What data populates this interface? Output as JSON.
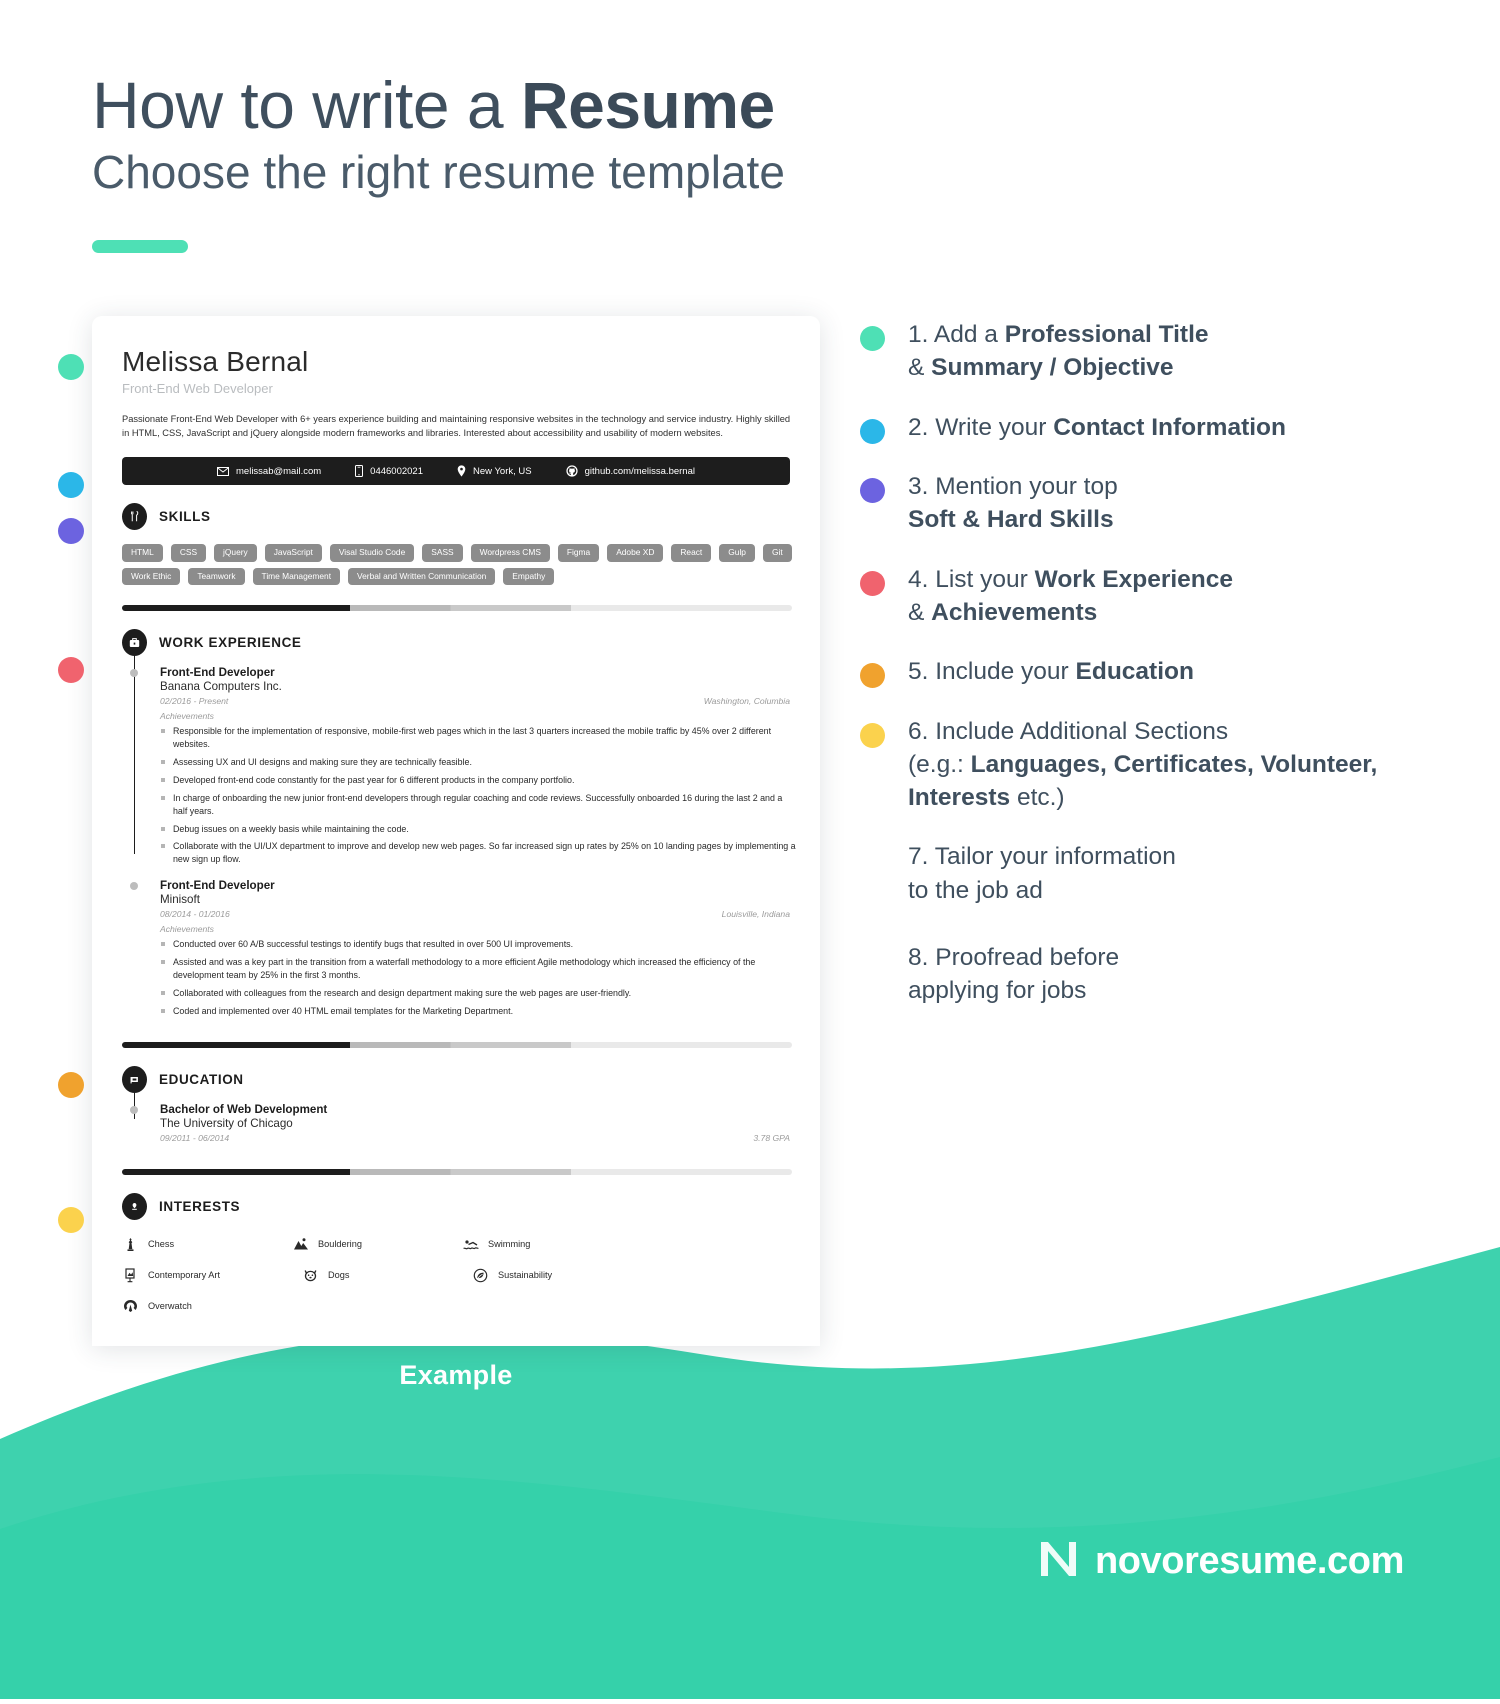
{
  "header": {
    "title_plain": "How to write a ",
    "title_bold": "Resume",
    "subtitle": "Choose the right resume template"
  },
  "colors": {
    "teal": "#4ee0b5",
    "blue": "#2bb7e8",
    "purple": "#6c63e0",
    "red": "#f0636e",
    "orange": "#f0a22e",
    "yellow": "#fbd24d",
    "dark_text": "#3f4f5e"
  },
  "resume": {
    "name": "Melissa Bernal",
    "role": "Front-End Web Developer",
    "summary": "Passionate Front-End Web Developer with 6+ years experience building and maintaining responsive websites in the technology and service industry. Highly skilled in HTML, CSS, JavaScript and jQuery alongside modern frameworks and libraries. Interested about accessibility and usability of modern websites.",
    "contact": [
      {
        "icon": "envelope-icon",
        "value": "melissab@mail.com"
      },
      {
        "icon": "phone-icon",
        "value": "0446002021"
      },
      {
        "icon": "location-pin-icon",
        "value": "New York, US"
      },
      {
        "icon": "github-icon",
        "value": "github.com/melissa.bernal"
      }
    ],
    "skills": {
      "title": "SKILLS",
      "icon": "skills-badge-icon",
      "tags": [
        "HTML",
        "CSS",
        "jQuery",
        "JavaScript",
        "Visal Studio Code",
        "SASS",
        "Wordpress CMS",
        "Figma",
        "Adobe XD",
        "React",
        "Gulp",
        "Git",
        "Work Ethic",
        "Teamwork",
        "Time Management",
        "Verbal and Written Communication",
        "Empathy"
      ]
    },
    "work": {
      "title": "WORK EXPERIENCE",
      "icon": "briefcase-badge-icon",
      "entries": [
        {
          "title": "Front-End Developer",
          "organization": "Banana Computers Inc.",
          "date": "02/2016 - Present",
          "location": "Washington, Columbia",
          "achievements_label": "Achievements",
          "bullets": [
            "Responsible for the implementation of responsive, mobile-first web pages which in the last 3 quarters increased the mobile traffic by 45% over 2 different websites.",
            "Assessing UX and UI designs and making sure they are technically feasible.",
            "Developed front-end code constantly for the past year for 6 different products in the company portfolio.",
            "In charge of onboarding the new junior front-end developers through regular coaching and code reviews. Successfully onboarded 16 during the last 2 and a half years.",
            "Debug issues on a weekly basis while maintaining the code.",
            "Collaborate with the UI/UX department to improve and develop new web pages. So far increased sign up rates by 25% on 10 landing pages by implementing a new sign up flow."
          ]
        },
        {
          "title": "Front-End Developer",
          "organization": "Minisoft",
          "date": "08/2014 - 01/2016",
          "location": "Louisville, Indiana",
          "achievements_label": "Achievements",
          "bullets": [
            "Conducted over 60 A/B successful testings to identify bugs that resulted in over 500 UI improvements.",
            "Assisted and was a key part in the transition from a waterfall methodology to a more efficient Agile methodology which increased the efficiency of the development team by 25% in the first 3 months.",
            "Collaborated with colleagues from the research and design department making sure the web pages are user-friendly.",
            "Coded and implemented over 40 HTML email templates for the Marketing Department."
          ]
        }
      ]
    },
    "education": {
      "title": "EDUCATION",
      "icon": "graduation-badge-icon",
      "entries": [
        {
          "title": "Bachelor of Web Development",
          "organization": "The University of Chicago",
          "date": "09/2011 - 06/2014",
          "gpa": "3.78 GPA"
        }
      ]
    },
    "interests": {
      "title": "INTERESTS",
      "icon": "interests-badge-icon",
      "items": [
        {
          "icon": "chess-icon",
          "label": "Chess"
        },
        {
          "icon": "bouldering-icon",
          "label": "Bouldering"
        },
        {
          "icon": "swimming-icon",
          "label": "Swimming"
        },
        {
          "icon": "art-icon",
          "label": "Contemporary Art"
        },
        {
          "icon": "dog-icon",
          "label": "Dogs"
        },
        {
          "icon": "sustainability-icon",
          "label": "Sustainability"
        },
        {
          "icon": "overwatch-icon",
          "label": "Overwatch"
        }
      ]
    }
  },
  "example_label": "Example",
  "steps": [
    {
      "color": "#4ee0b5",
      "line1_plain": "1. Add a ",
      "line1_bold": "Professional Title",
      "line2_plain": "& ",
      "line2_bold": "Summary / Objective",
      "has_dot": true
    },
    {
      "color": "#2bb7e8",
      "line1_plain": "2. Write your ",
      "line1_bold": "Contact Information",
      "line2_plain": "",
      "line2_bold": "",
      "has_dot": true
    },
    {
      "color": "#6c63e0",
      "line1_plain": "3. Mention your top",
      "line1_bold": "",
      "line2_plain": "",
      "line2_bold": "Soft & Hard Skills",
      "has_dot": true
    },
    {
      "color": "#f0636e",
      "line1_plain": "4. List your ",
      "line1_bold": "Work Experience",
      "line2_plain": "& ",
      "line2_bold": "Achievements",
      "has_dot": true
    },
    {
      "color": "#f0a22e",
      "line1_plain": "5. Include your ",
      "line1_bold": "Education",
      "line2_plain": "",
      "line2_bold": "",
      "has_dot": true
    },
    {
      "color": "#fbd24d",
      "line1_plain": "6. Include Additional Sections",
      "line1_bold": "",
      "line2_plain": "(e.g.: ",
      "line2_bold": "Languages, Certificates, Volunteer, Interests",
      "line2_tail": " etc.)",
      "has_dot": true
    },
    {
      "color": "",
      "line1_plain": "7. Tailor your information",
      "line1_bold": "",
      "line2_plain": "to the job ad",
      "line2_bold": "",
      "has_dot": false
    },
    {
      "color": "",
      "line1_plain": "8. Proofread before",
      "line1_bold": "",
      "line2_plain": "applying for jobs",
      "line2_bold": "",
      "has_dot": false
    }
  ],
  "brand": {
    "logo_icon": "novoresume-n-logo",
    "name": "novoresume.com"
  }
}
